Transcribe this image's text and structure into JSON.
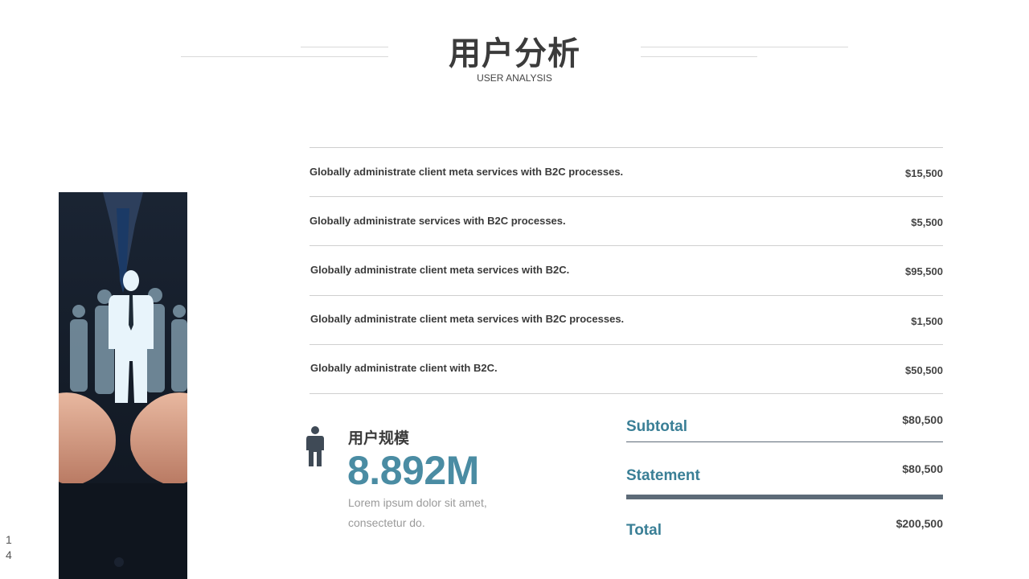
{
  "header": {
    "title": "用户分析",
    "subtitle": "USER ANALYSIS"
  },
  "table": {
    "rows": [
      {
        "text": "Globally administrate client meta services with B2C processes.",
        "amount": "$15,500"
      },
      {
        "text": "Globally administrate services with B2C processes.",
        "amount": "$5,500"
      },
      {
        "text": "Globally administrate client meta services with B2C.",
        "amount": "$95,500"
      },
      {
        "text": "Globally administrate client meta services with B2C processes.",
        "amount": "$1,500"
      },
      {
        "text": "Globally administrate client with B2C.",
        "amount": "$50,500"
      }
    ]
  },
  "user_scale": {
    "label": "用户规模",
    "value": "8.892M",
    "desc_line1": "Lorem ipsum dolor sit amet,",
    "desc_line2": "consectetur do."
  },
  "summary": {
    "subtotal_label": "Subtotal",
    "subtotal_amount": "$80,500",
    "statement_label": "Statement",
    "statement_amount": "$80,500",
    "total_label": "Total",
    "total_amount": "$200,500"
  },
  "page_number": "14",
  "colors": {
    "accent": "#4a8ca3",
    "accent_dark": "#3a7f96",
    "bar": "#5d6b78"
  },
  "icons": {
    "person": "person-icon",
    "photo": "hands-holding-businessman-figure"
  }
}
